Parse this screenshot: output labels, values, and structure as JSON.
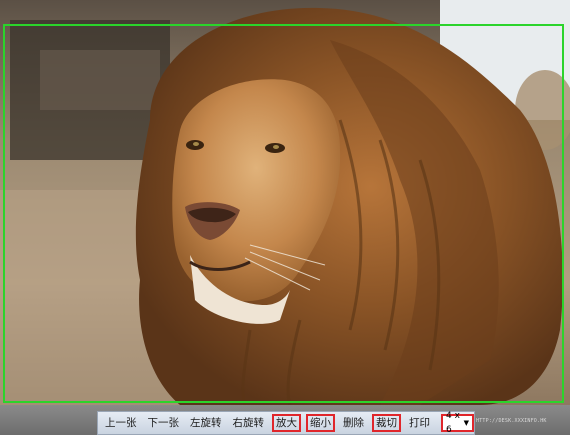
{
  "toolbar": {
    "prev_label": "上一张",
    "next_label": "下一张",
    "rotate_left_label": "左旋转",
    "rotate_right_label": "右旋转",
    "zoom_in_label": "放大",
    "zoom_out_label": "缩小",
    "delete_label": "删除",
    "crop_label": "裁切",
    "print_label": "打印",
    "size_select": {
      "selected": "4 x 6",
      "icon": "chevron-down-icon"
    }
  },
  "photo": {
    "subject": "lion"
  },
  "credit": "HTTP://DESK.XXXINFO.HK",
  "colors": {
    "crop_frame": "#2bd42b",
    "highlight": "#e0262b",
    "toolbar_bg": "#dfe6ef"
  }
}
